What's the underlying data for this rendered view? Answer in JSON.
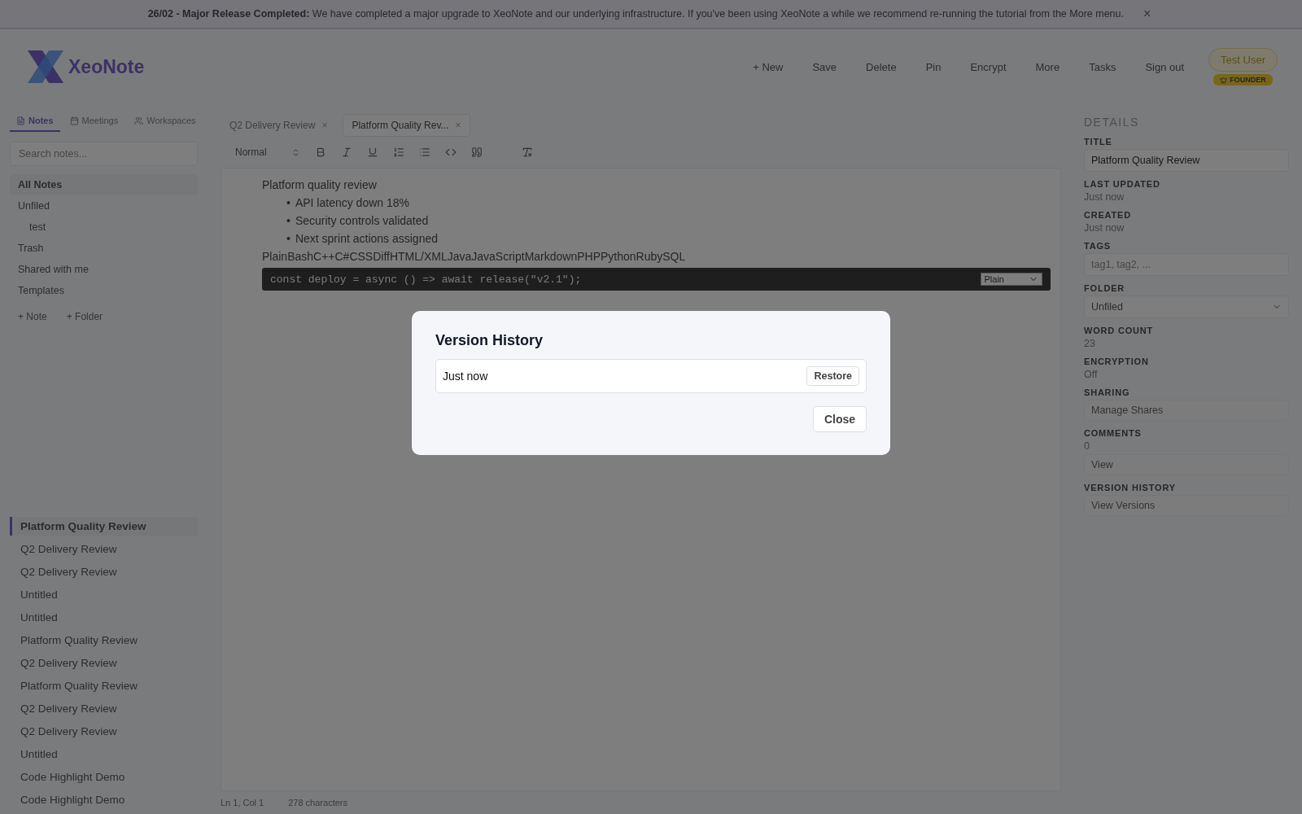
{
  "banner": {
    "message": "**26/02 - Major Release Completed:** We have completed a major upgrade to XeoNote and our underlying infrastructure. If you've been using XeoNote a while we recommend re-running the tutorial from the More menu.",
    "close": "×"
  },
  "header": {
    "logo": "XeoNote",
    "nav": [
      "+ New",
      "Save",
      "Delete",
      "Pin",
      "Encrypt",
      "More",
      "Tasks",
      "Sign out"
    ],
    "user": {
      "name": "Test User",
      "badge": "FOUNDER"
    }
  },
  "sidebar": {
    "tabs": [
      {
        "label": "Notes",
        "selected": true
      },
      {
        "label": "Meetings",
        "selected": false
      },
      {
        "label": "Workspaces",
        "selected": false
      }
    ],
    "search": {
      "placeholder": "Search notes..."
    },
    "folders": [
      {
        "label": "All Notes",
        "selected": true
      },
      {
        "label": "Unfiled",
        "selected": false,
        "children": [
          {
            "label": "test",
            "selected": false
          }
        ]
      },
      {
        "label": "Trash",
        "selected": false
      },
      {
        "label": "Shared with me",
        "selected": false
      },
      {
        "label": "Templates",
        "selected": false
      }
    ],
    "actions": [
      "+ Note",
      "+ Folder"
    ],
    "notes": [
      {
        "title": "Platform Quality Review",
        "selected": true
      },
      {
        "title": "Q2 Delivery Review",
        "selected": false
      },
      {
        "title": "Q2 Delivery Review",
        "selected": false
      },
      {
        "title": "Untitled",
        "selected": false
      },
      {
        "title": "Untitled",
        "selected": false
      },
      {
        "title": "Platform Quality Review",
        "selected": false
      },
      {
        "title": "Q2 Delivery Review",
        "selected": false
      },
      {
        "title": "Platform Quality Review",
        "selected": false
      },
      {
        "title": "Q2 Delivery Review",
        "selected": false
      },
      {
        "title": "Q2 Delivery Review",
        "selected": false
      },
      {
        "title": "Untitled",
        "selected": false
      },
      {
        "title": "Code Highlight Demo",
        "selected": false
      },
      {
        "title": "Code Highlight Demo",
        "selected": false
      }
    ]
  },
  "editor": {
    "tabs": [
      {
        "label": "Q2 Delivery Review",
        "selected": false
      },
      {
        "label": "Platform Quality Rev...",
        "selected": true
      }
    ],
    "tab_close": "×",
    "toolbar": {
      "block_style": "Normal"
    },
    "lines": [
      {
        "kind": "paragraph",
        "text": "Platform quality review"
      },
      {
        "kind": "bullet",
        "marker": "•",
        "text": "API latency down 18%"
      },
      {
        "kind": "bullet",
        "marker": "•",
        "text": "Security controls validated"
      },
      {
        "kind": "bullet",
        "marker": "•",
        "text": "Next sprint actions assigned"
      },
      {
        "kind": "paragraph",
        "text": "PlainBashC++C#CSSDiffHTML/XMLJavaJavaScriptMarkdownPHPPythonRubySQL"
      },
      {
        "kind": "code",
        "text": "const deploy = async () => await release(\"v2.1\");",
        "language": "Plain"
      }
    ],
    "status": [
      "Ln 1, Col 1",
      "278 characters"
    ]
  },
  "details": {
    "heading": "DETAILS",
    "fields": [
      {
        "kind": "input",
        "label": "TITLE",
        "value": "Platform Quality Review"
      },
      {
        "kind": "text",
        "label": "LAST UPDATED",
        "value": "Just now"
      },
      {
        "kind": "text",
        "label": "CREATED",
        "value": "Just now"
      },
      {
        "kind": "input",
        "label": "TAGS",
        "placeholder": "tag1, tag2, ..."
      },
      {
        "kind": "select",
        "label": "FOLDER",
        "value": "Unfiled"
      },
      {
        "kind": "text",
        "label": "WORD COUNT",
        "value": "23"
      },
      {
        "kind": "text",
        "label": "ENCRYPTION",
        "value": "Off"
      },
      {
        "kind": "button",
        "label": "SHARING",
        "action": "Manage Shares"
      },
      {
        "kind": "text",
        "label": "COMMENTS",
        "value": "0",
        "action": "View"
      },
      {
        "kind": "button",
        "label": "VERSION HISTORY",
        "action": "View Versions"
      }
    ]
  },
  "modal": {
    "title": "Version History",
    "versions": [
      {
        "label": "Just now",
        "action": "Restore"
      }
    ],
    "close": "Close"
  }
}
